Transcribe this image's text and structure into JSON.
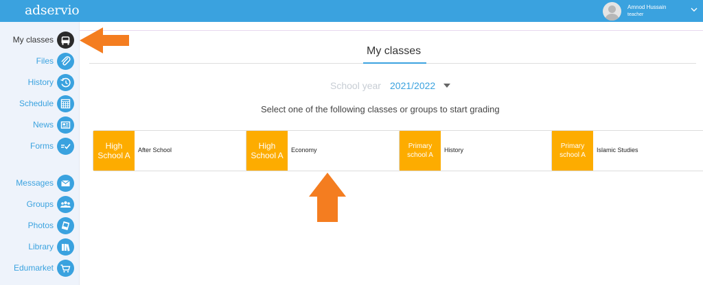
{
  "app": {
    "logo": "adservio"
  },
  "user": {
    "name": "Amnod Hussain",
    "role": "teacher"
  },
  "sidebar": {
    "items": [
      {
        "label": "My classes",
        "icon": "classes-icon",
        "active": true
      },
      {
        "label": "Files",
        "icon": "paperclip-icon"
      },
      {
        "label": "History",
        "icon": "history-icon"
      },
      {
        "label": "Schedule",
        "icon": "calendar-icon"
      },
      {
        "label": "News",
        "icon": "news-icon"
      },
      {
        "label": "Forms",
        "icon": "forms-icon"
      },
      {
        "label": "Messages",
        "icon": "mail-icon"
      },
      {
        "label": "Groups",
        "icon": "groups-icon"
      },
      {
        "label": "Photos",
        "icon": "photos-icon"
      },
      {
        "label": "Library",
        "icon": "library-icon"
      },
      {
        "label": "Edumarket",
        "icon": "cart-icon"
      }
    ]
  },
  "main": {
    "title": "My classes",
    "school_year_label": "School year",
    "school_year_value": "2021/2022",
    "instruction": "Select one of the following classes or groups to start grading",
    "classes": [
      {
        "group": "High School A",
        "name": "After School"
      },
      {
        "group": "High School A",
        "name": "Economy"
      },
      {
        "group": "Primary school A",
        "name": "History"
      },
      {
        "group": "Primary school A",
        "name": "Islamic Studies"
      }
    ]
  },
  "colors": {
    "brand": "#3aa2df",
    "class_swatch": "#fdac00",
    "annotation_arrow": "#f47d20"
  }
}
